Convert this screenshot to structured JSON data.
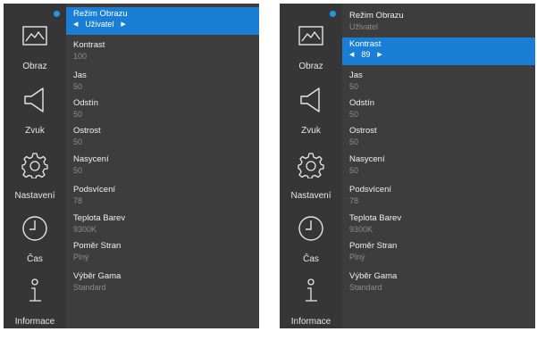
{
  "colors": {
    "panel": "#3d3d3d",
    "sidebar": "#363636",
    "highlight": "#1a7fd4",
    "dot": "#2196e3",
    "muted": "#8c8c8c"
  },
  "sidebar": [
    {
      "label": "Obraz",
      "icon": "picture-icon"
    },
    {
      "label": "Zvuk",
      "icon": "speaker-icon"
    },
    {
      "label": "Nastavení",
      "icon": "gear-icon"
    },
    {
      "label": "Čas",
      "icon": "clock-icon"
    },
    {
      "label": "Informace",
      "icon": "info-icon"
    }
  ],
  "screens": [
    {
      "items": [
        {
          "label": "Režim Obrazu",
          "value": "Uživatel"
        },
        {
          "label": "Kontrast",
          "value": "100"
        },
        {
          "label": "Jas",
          "value": "50"
        },
        {
          "label": "Odstín",
          "value": "50"
        },
        {
          "label": "Ostrost",
          "value": "50"
        },
        {
          "label": "Nasycení",
          "value": "50"
        },
        {
          "label": "Podsvícení",
          "value": "78"
        },
        {
          "label": "Teplota Barev",
          "value": "9300K"
        },
        {
          "label": "Poměr Stran",
          "value": "Plný"
        },
        {
          "label": "Výběr Gama",
          "value": "Standard"
        }
      ],
      "selected_item": "Režim Obrazu",
      "arrow_left": "◀",
      "arrow_right": "▶"
    },
    {
      "items": [
        {
          "label": "Režim Obrazu",
          "value": "Uživatel"
        },
        {
          "label": "Kontrast",
          "value": "89"
        },
        {
          "label": "Jas",
          "value": "50"
        },
        {
          "label": "Odstín",
          "value": "50"
        },
        {
          "label": "Ostrost",
          "value": "50"
        },
        {
          "label": "Nasycení",
          "value": "50"
        },
        {
          "label": "Podsvícení",
          "value": "78"
        },
        {
          "label": "Teplota Barev",
          "value": "9300K"
        },
        {
          "label": "Poměr Stran",
          "value": "Plný"
        },
        {
          "label": "Výběr Gama",
          "value": "Standard"
        }
      ],
      "selected_item": "Kontrast",
      "arrow_left": "◀",
      "arrow_right": "▶"
    }
  ]
}
